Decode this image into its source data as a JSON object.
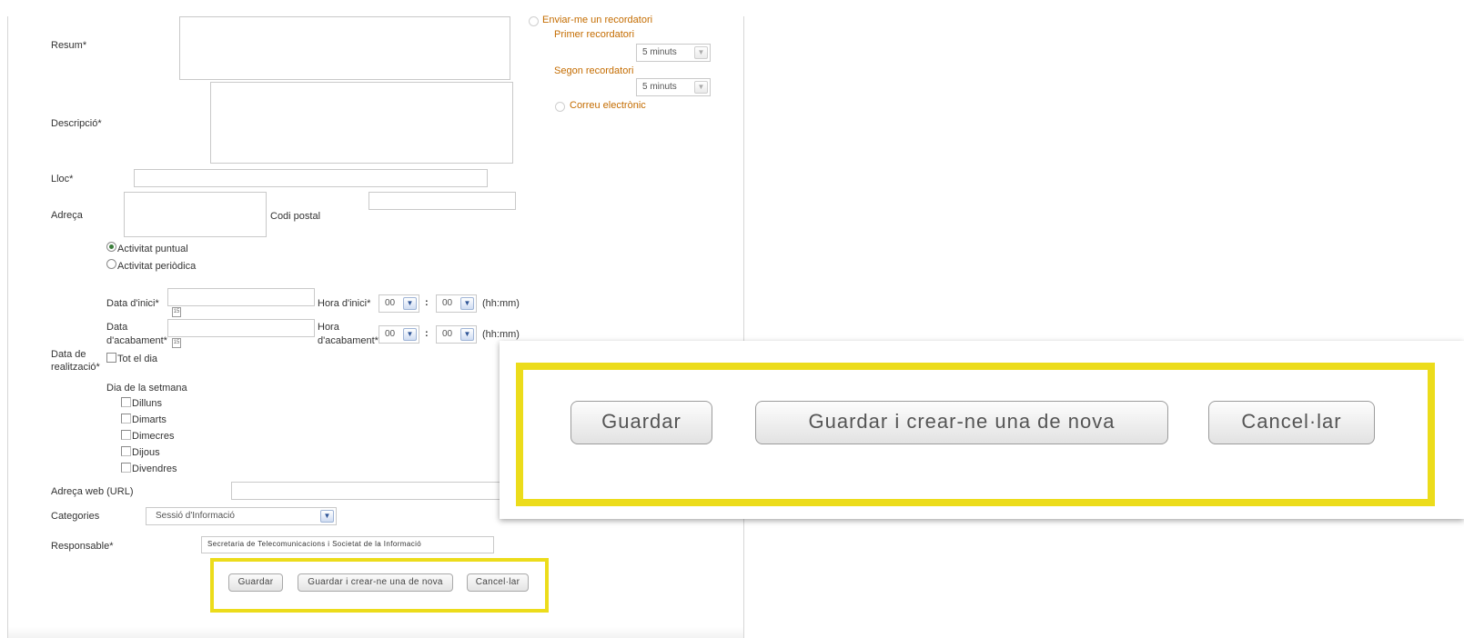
{
  "reminder": {
    "send_label": "Enviar-me un recordatori",
    "first_label": "Primer recordatori",
    "first_value": "5 minuts",
    "second_label": "Segon recordatori",
    "second_value": "5 minuts",
    "email_label": "Correu electrònic"
  },
  "form": {
    "summary_label": "Resum*",
    "description_label": "Descripció*",
    "place_label": "Lloc*",
    "address_label": "Adreça",
    "postal_label": "Codi postal",
    "activity_single": "Activitat puntual",
    "activity_periodic": "Activitat periòdica",
    "date_section_label_1": "Data de",
    "date_section_label_2": "realització*",
    "start_date_label": "Data d'inici*",
    "start_time_label": "Hora d'inici*",
    "end_date_label_1": "Data",
    "end_date_label_2": "d'acabament*",
    "end_time_label_1": "Hora",
    "end_time_label_2": "d'acabament*",
    "hour_value": "00",
    "minute_value": "00",
    "time_sep": ":",
    "time_format": "(hh:mm)",
    "all_day": "Tot el dia",
    "weekday_label": "Dia de la setmana",
    "weekdays": [
      "Dilluns",
      "Dimarts",
      "Dimecres",
      "Dijous",
      "Divendres"
    ],
    "url_label": "Adreça web (URL)",
    "categories_label": "Categories",
    "categories_value": "Sessió d'Informació",
    "responsible_label": "Responsable*",
    "responsible_value": "Secretaria de Telecomunicacions i Societat de la Informació",
    "calendar_glyph": "15"
  },
  "buttons": {
    "save": "Guardar",
    "save_new": "Guardar i crear-ne una de nova",
    "cancel": "Cancel·lar"
  },
  "colors": {
    "highlight": "#ecdc1b",
    "reminder_text": "#c46c00"
  }
}
